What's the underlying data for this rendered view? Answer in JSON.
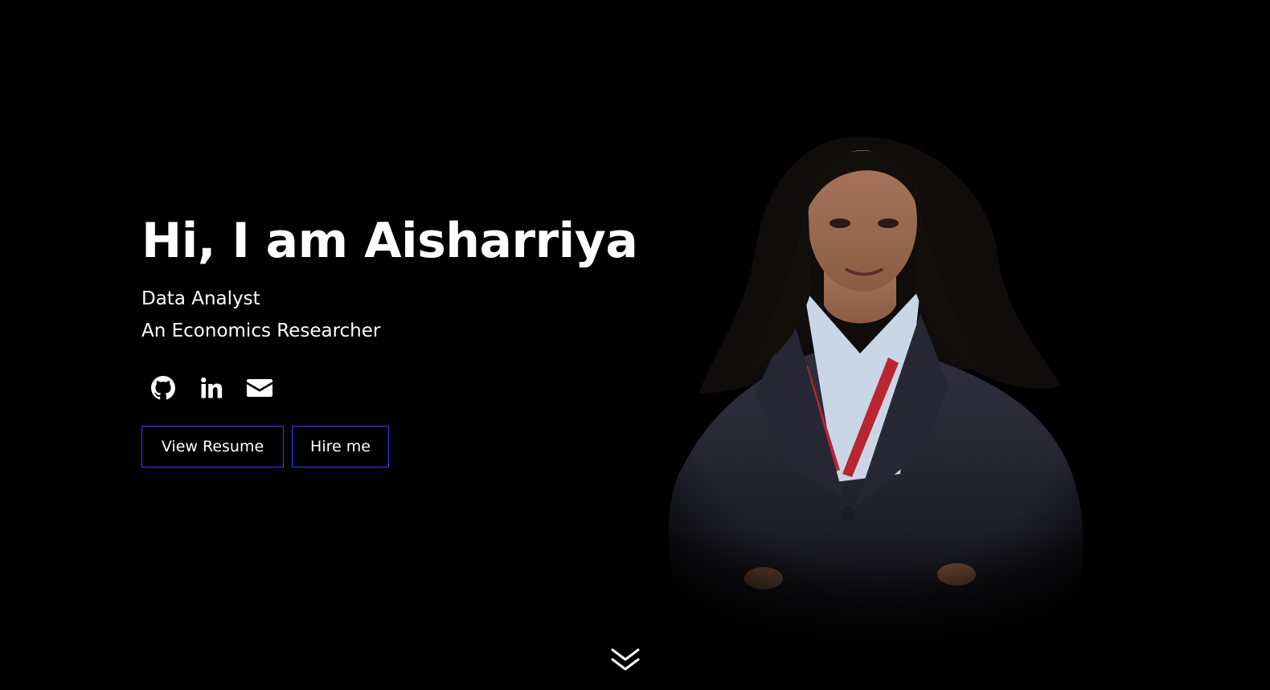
{
  "hero": {
    "headline": "Hi, I am Aisharriya",
    "roles": [
      "Data Analyst",
      "An Economics Researcher"
    ],
    "social_icons": [
      "github-icon",
      "linkedin-icon",
      "envelope-icon"
    ],
    "buttons": {
      "resume_label": "View Resume",
      "hire_label": "Hire me"
    },
    "scroll_icon": "double-chevron-down-icon"
  },
  "colors": {
    "background": "#000000",
    "text": "#ffffff",
    "button_border": "#3b3bff"
  }
}
